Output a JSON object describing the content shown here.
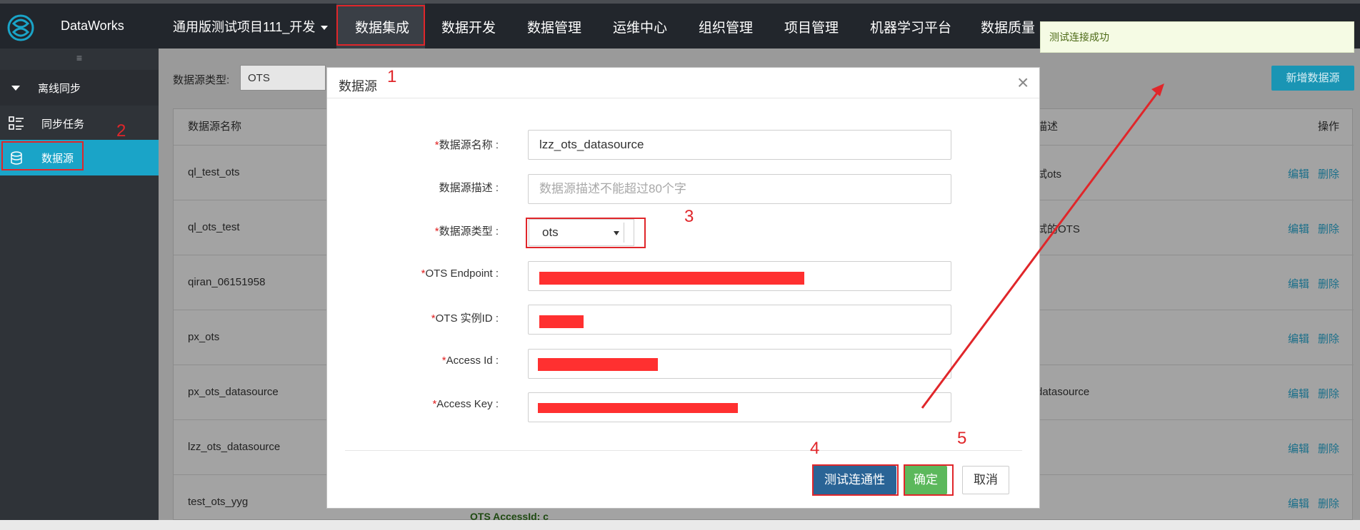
{
  "app": {
    "name": "DataWorks",
    "project": "通用版测试项目111_开发"
  },
  "nav": {
    "items": [
      "数据集成",
      "数据开发",
      "数据管理",
      "运维中心",
      "组织管理",
      "项目管理",
      "机器学习平台",
      "数据质量"
    ]
  },
  "sidebar": {
    "collapse_glyph": "≡",
    "group": "离线同步",
    "items": [
      {
        "label": "同步任务"
      },
      {
        "label": "数据源"
      }
    ]
  },
  "filter": {
    "label": "数据源类型:",
    "value": "OTS"
  },
  "toolbar": {
    "add_datasource": "新增数据源"
  },
  "table": {
    "headers": {
      "name": "数据源名称",
      "desc": "描述",
      "ops": "操作"
    },
    "rows": [
      {
        "name": "ql_test_ots",
        "desc": "试ots"
      },
      {
        "name": "ql_ots_test",
        "desc": "试的OTS"
      },
      {
        "name": "qiran_06151958",
        "desc": ""
      },
      {
        "name": "px_ots",
        "desc": ""
      },
      {
        "name": "px_ots_datasource",
        "desc": "datasource"
      },
      {
        "name": "lzz_ots_datasource",
        "desc": ""
      },
      {
        "name": "test_ots_yyg",
        "desc": ""
      }
    ],
    "edit_label": "编辑",
    "delete_label": "删除",
    "partial_text": "OTS AccessId: c"
  },
  "modal": {
    "title": "数据源",
    "close_glyph": "×",
    "fields": {
      "name_label": "数据源名称",
      "name_value": "lzz_ots_datasource",
      "desc_label": "数据源描述",
      "desc_placeholder": "数据源描述不能超过80个字",
      "type_label": "数据源类型",
      "type_value": "ots",
      "endpoint_label": "OTS Endpoint",
      "instance_label": "OTS 实例ID",
      "access_id_label": "Access Id",
      "access_key_label": "Access Key"
    },
    "buttons": {
      "test": "测试连通性",
      "ok": "确定",
      "cancel": "取消"
    }
  },
  "toast": {
    "message": "测试连接成功"
  },
  "annotations": [
    "1",
    "2",
    "3",
    "4",
    "5"
  ],
  "colors": {
    "accent": "#1aa4c8",
    "annotation": "#e0262a",
    "test_button": "#2a6496",
    "ok_button": "#5cb85c"
  }
}
